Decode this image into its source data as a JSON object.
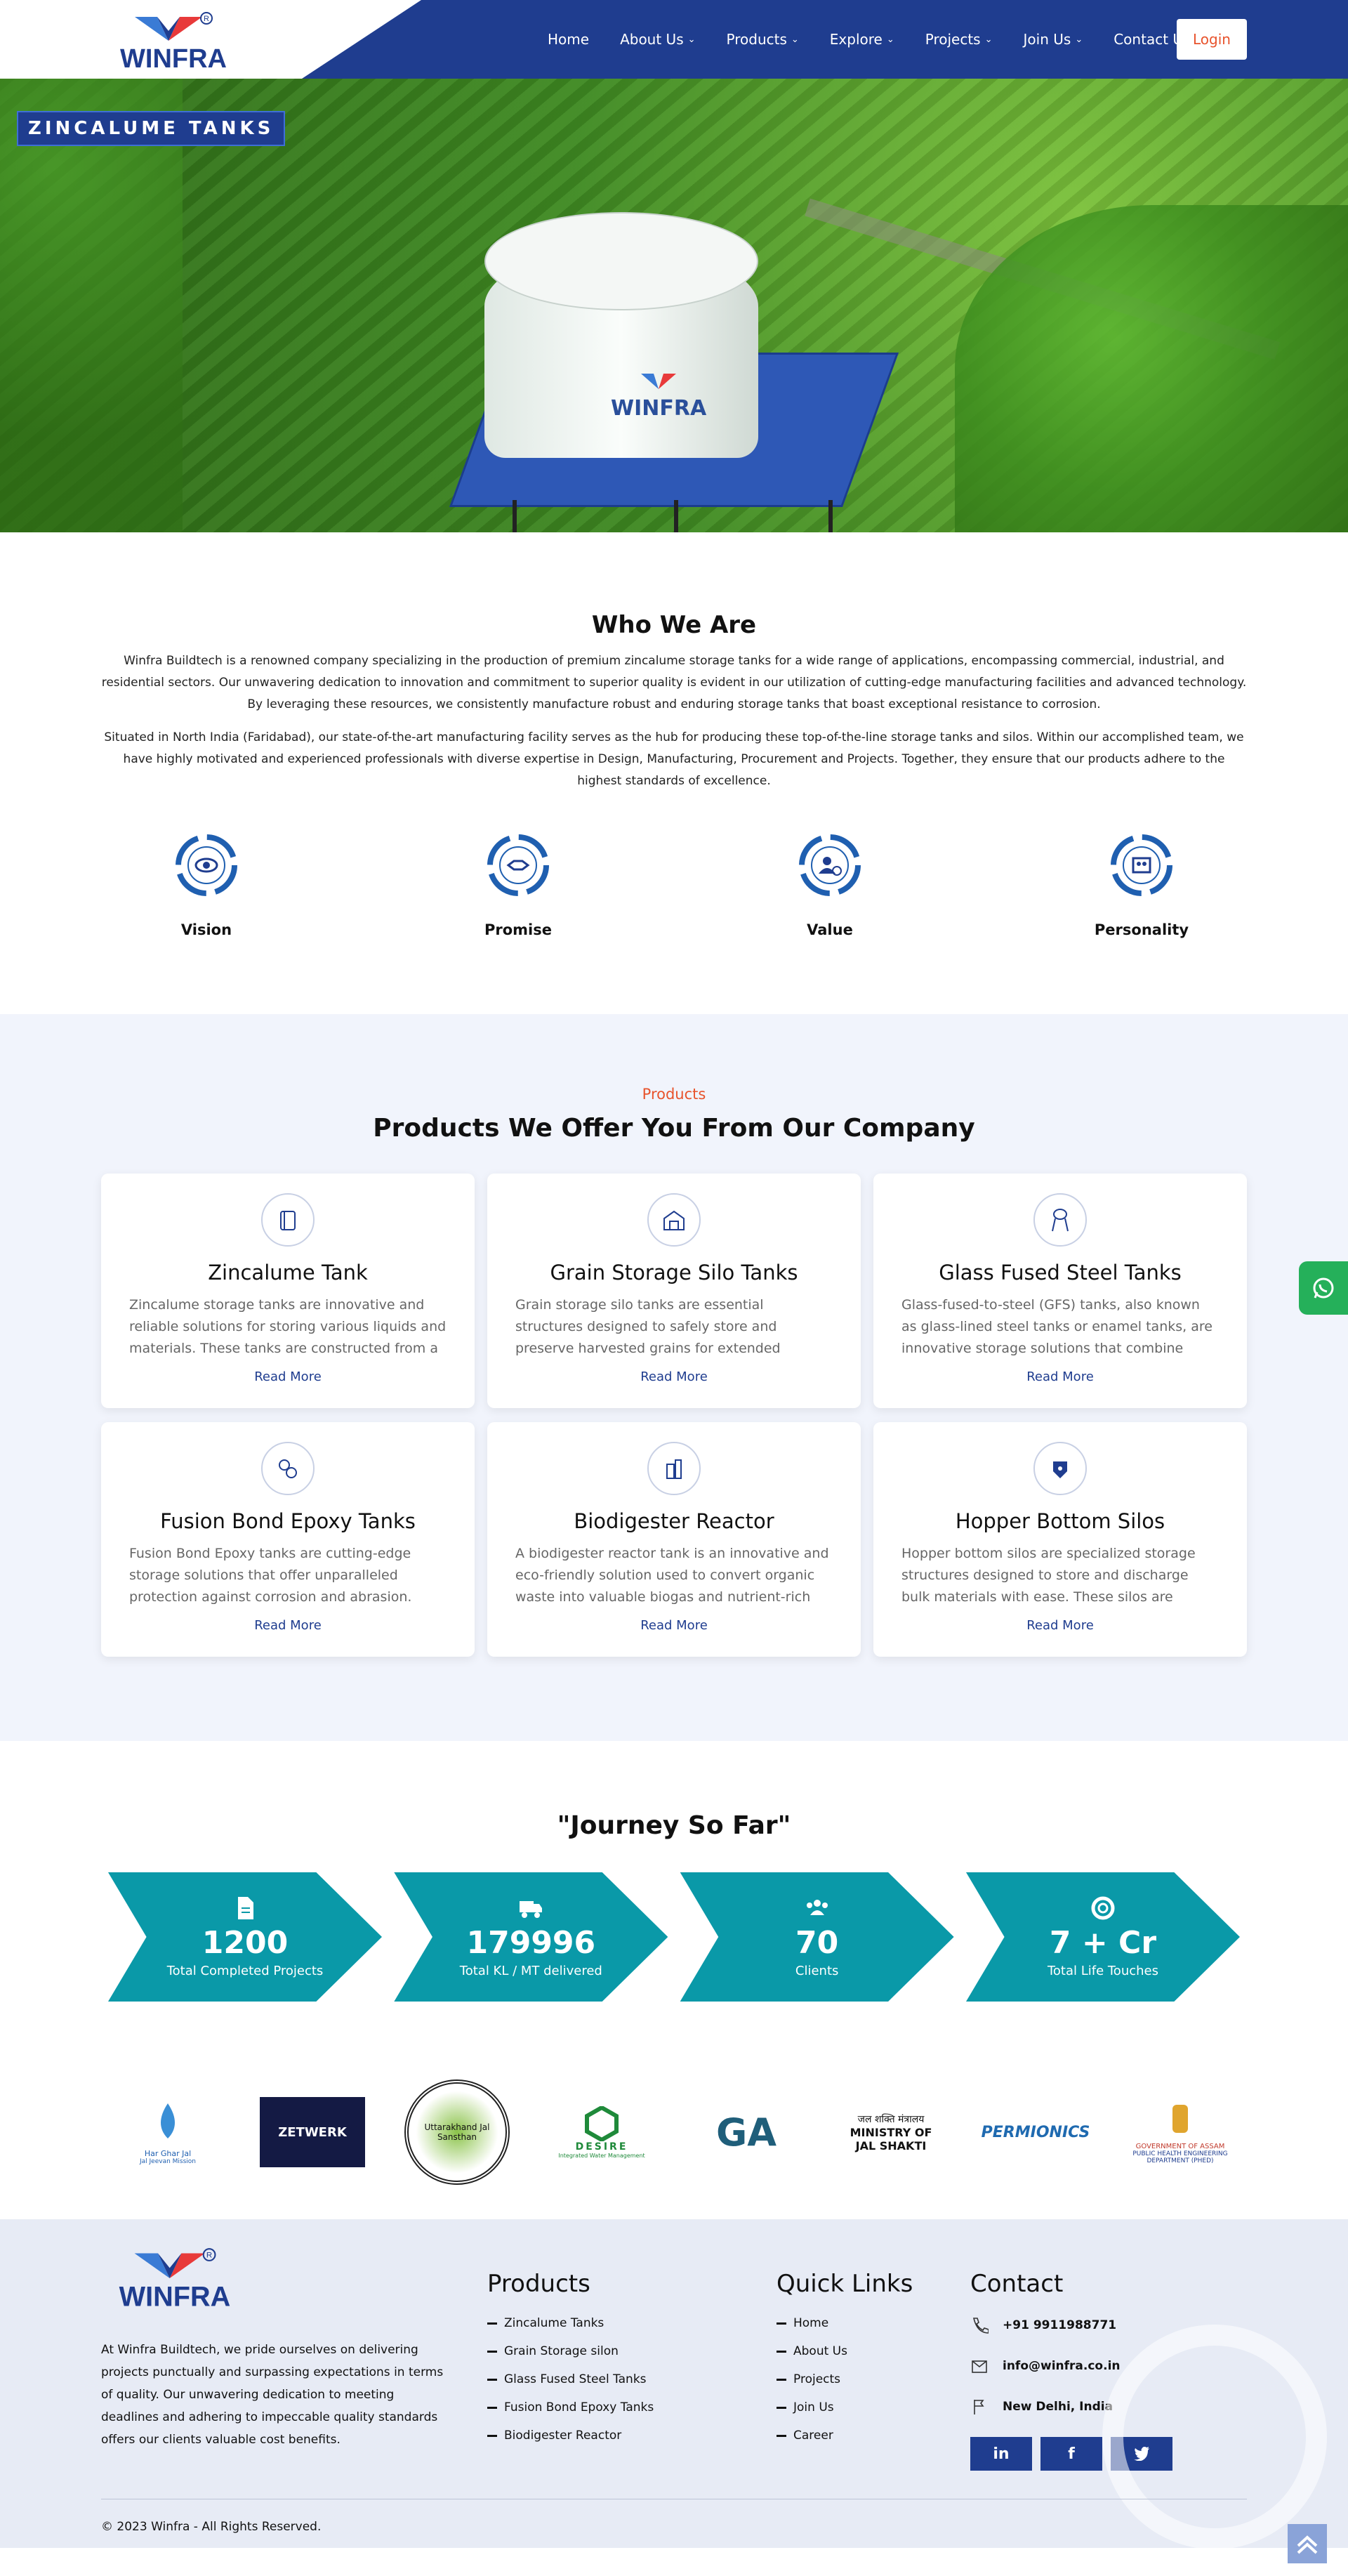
{
  "header": {
    "logo_text": "WINFRA",
    "nav": [
      {
        "label": "Home",
        "dropdown": false
      },
      {
        "label": "About Us",
        "dropdown": true
      },
      {
        "label": "Products",
        "dropdown": true
      },
      {
        "label": "Explore",
        "dropdown": true
      },
      {
        "label": "Projects",
        "dropdown": true
      },
      {
        "label": "Join Us",
        "dropdown": true
      },
      {
        "label": "Contact Us",
        "dropdown": false
      }
    ],
    "login_label": "Login",
    "colors": {
      "primary": "#1f3d8f",
      "accent": "#e8532c"
    }
  },
  "hero": {
    "title": "ZINCALUME TANKS",
    "tank_logo": "WINFRA"
  },
  "who": {
    "title": "Who We Are",
    "paragraphs": [
      "Winfra Buildtech is a renowned company specializing in the production of premium zincalume storage tanks for a wide range of applications, encompassing commercial, industrial, and residential sectors. Our unwavering dedication to innovation and commitment to superior quality is evident in our utilization of cutting-edge manufacturing facilities and advanced technology. By leveraging these resources, we consistently manufacture robust and enduring storage tanks that boast exceptional resistance to corrosion.",
      "Situated in North India (Faridabad), our state-of-the-art manufacturing facility serves as the hub for producing these top-of-the-line storage tanks and silos. Within our accomplished team, we have highly motivated and experienced professionals with diverse expertise in Design, Manufacturing, Procurement and Projects. Together, they ensure that our products adhere to the highest standards of excellence."
    ],
    "values": [
      {
        "label": "Vision",
        "icon": "eye-icon"
      },
      {
        "label": "Promise",
        "icon": "handshake-icon"
      },
      {
        "label": "Value",
        "icon": "user-value-icon"
      },
      {
        "label": "Personality",
        "icon": "team-icon"
      }
    ]
  },
  "products": {
    "kicker": "Products",
    "title": "Products We Offer You From Our Company",
    "read_more": "Read More",
    "items": [
      {
        "title": "Zincalume Tank",
        "icon": "tank-icon",
        "desc": "Zincalume storage tanks are innovative and reliable solutions for storing various liquids and materials. These tanks are constructed from a combination ..."
      },
      {
        "title": "Grain Storage Silo Tanks",
        "icon": "silo-icon",
        "desc": "Grain storage silo tanks are essential structures designed to safely store and preserve harvested grains for extended periods. These cylindrical..."
      },
      {
        "title": "Glass Fused Steel Tanks",
        "icon": "water-tower-icon",
        "desc": "Glass-fused-to-steel (GFS) tanks, also known as glass-lined steel tanks or enamel tanks, are innovative storage solutions that combine the..."
      },
      {
        "title": "Fusion Bond Epoxy Tanks",
        "icon": "gears-icon",
        "desc": "Fusion Bond Epoxy tanks are cutting-edge storage solutions that offer unparalleled protection against corrosion and abrasion. These tanks are..."
      },
      {
        "title": "Biodigester Reactor",
        "icon": "reactor-icon",
        "desc": "A biodigester reactor tank is an innovative and eco-friendly solution used to convert organic waste into valuable biogas and nutrient-rich fertilizers throu..."
      },
      {
        "title": "Hopper Bottom Silos",
        "icon": "hopper-icon",
        "desc": "Hopper bottom silos are specialized storage structures designed to store and discharge bulk materials with ease. These silos are commonly..."
      }
    ]
  },
  "journey": {
    "title": "\"Journey So Far\"",
    "stats": [
      {
        "value": "1200",
        "label": "Total Completed Projects",
        "icon": "document-icon"
      },
      {
        "value": "179996",
        "label": "Total KL / MT delivered",
        "icon": "truck-icon"
      },
      {
        "value": "70",
        "label": "Clients",
        "icon": "users-icon"
      },
      {
        "value": "7 + Cr",
        "label": "Total Life Touches",
        "icon": "lifebuoy-icon"
      }
    ]
  },
  "clients": [
    {
      "name": "Har Ghar Jal",
      "sub": "Jal Jeevan Mission"
    },
    {
      "name": "ZETWERK"
    },
    {
      "name": "Uttarakhand Jal Sansthan"
    },
    {
      "name": "DESIRE",
      "sub": "Integrated Water Management"
    },
    {
      "name": "GA"
    },
    {
      "name": "जल शक्ति मंत्रालय",
      "sub": "MINISTRY OF JAL SHAKTI"
    },
    {
      "name": "PERMIONICS"
    },
    {
      "name": "GOVERNMENT OF ASSAM",
      "sub": "PUBLIC HEALTH ENGINEERING DEPARTMENT (PHED)"
    }
  ],
  "footer": {
    "about": "At Winfra Buildtech, we pride ourselves on delivering projects punctually and surpassing expectations in terms of quality. Our unwavering dedication to meeting deadlines and adhering to impeccable quality standards offers our clients valuable cost benefits.",
    "products_title": "Products",
    "products": [
      "Zincalume Tanks",
      "Grain Storage silon",
      "Glass Fused Steel Tanks",
      "Fusion Bond Epoxy Tanks",
      "Biodigester Reactor"
    ],
    "links_title": "Quick Links",
    "links": [
      "Home",
      "About Us",
      "Projects",
      "Join Us",
      "Career"
    ],
    "contact_title": "Contact",
    "phone": "+91 9911988771",
    "email": "info@winfra.co.in",
    "location": "New Delhi, India",
    "socials": [
      "in",
      "f",
      "t"
    ],
    "copyright": "© 2023 Winfra - All Rights Reserved."
  }
}
